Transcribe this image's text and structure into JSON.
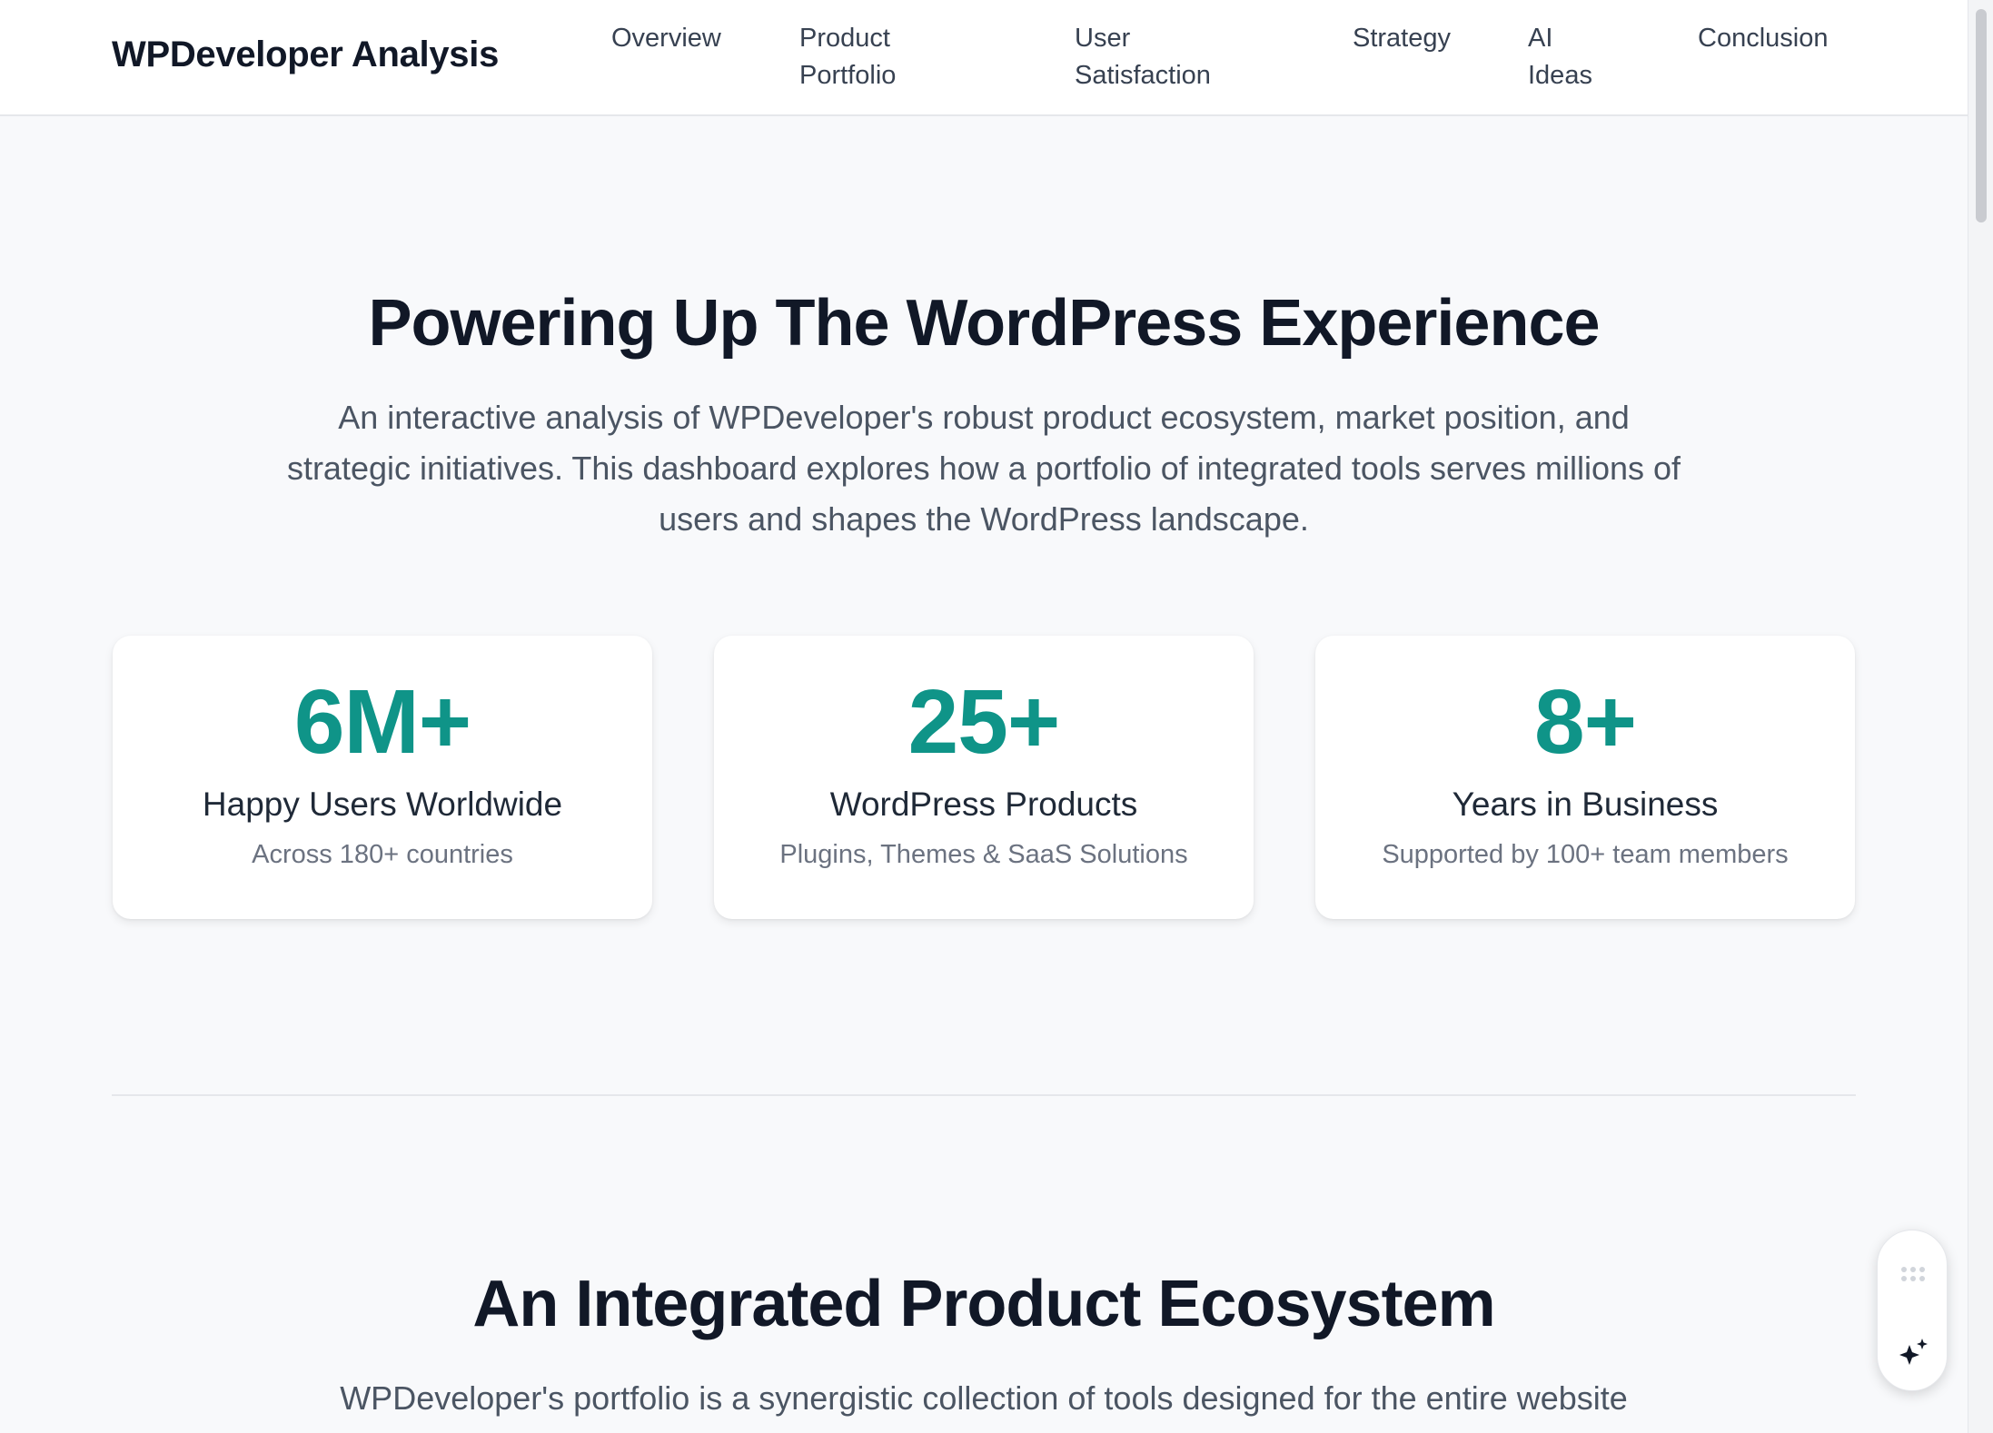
{
  "header": {
    "brand": "WPDeveloper Analysis",
    "nav": [
      {
        "line1": "Overview",
        "line2": ""
      },
      {
        "line1": "Product",
        "line2": "Portfolio"
      },
      {
        "line1": "User",
        "line2": "Satisfaction"
      },
      {
        "line1": "Strategy",
        "line2": ""
      },
      {
        "line1": "AI",
        "line2": "Ideas"
      },
      {
        "line1": "Conclusion",
        "line2": ""
      }
    ]
  },
  "hero": {
    "title": "Powering Up The WordPress Experience",
    "subtitle": "An interactive analysis of WPDeveloper's robust product ecosystem, market position, and strategic initiatives. This dashboard explores how a portfolio of integrated tools serves millions of users and shapes the WordPress landscape."
  },
  "stats": [
    {
      "value": "6M+",
      "label": "Happy Users Worldwide",
      "sub": "Across 180+ countries"
    },
    {
      "value": "25+",
      "label": "WordPress Products",
      "sub": "Plugins, Themes & SaaS Solutions"
    },
    {
      "value": "8+",
      "label": "Years in Business",
      "sub": "Supported by 100+ team members"
    }
  ],
  "ecosystem": {
    "title": "An Integrated Product Ecosystem",
    "subtitle": "WPDeveloper's portfolio is a synergistic collection of tools designed for the entire website"
  },
  "colors": {
    "accent": "#0f9488",
    "heading": "#111827",
    "body_text": "#4b5563",
    "background": "#f8f9fb"
  },
  "icons": {
    "widget_grip": "grip-dots-icon",
    "widget_action": "sparkle-icon"
  }
}
